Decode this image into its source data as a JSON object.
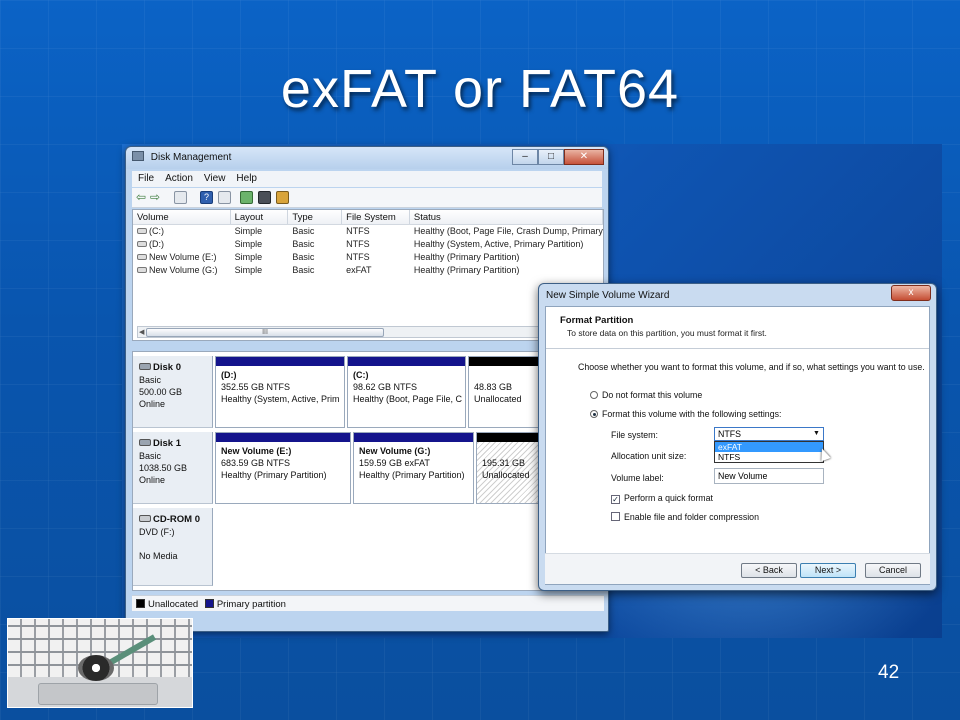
{
  "slide": {
    "title": "exFAT or FAT64",
    "page_number": "42"
  },
  "disk_management": {
    "window_title": "Disk Management",
    "menu": [
      "File",
      "Action",
      "View",
      "Help"
    ],
    "columns": [
      "Volume",
      "Layout",
      "Type",
      "File System",
      "Status"
    ],
    "volumes": [
      {
        "volume": "(C:)",
        "layout": "Simple",
        "type": "Basic",
        "fs": "NTFS",
        "status": "Healthy (Boot, Page File, Crash Dump, Primary"
      },
      {
        "volume": "(D:)",
        "layout": "Simple",
        "type": "Basic",
        "fs": "NTFS",
        "status": "Healthy (System, Active, Primary Partition)"
      },
      {
        "volume": "New Volume (E:)",
        "layout": "Simple",
        "type": "Basic",
        "fs": "NTFS",
        "status": "Healthy (Primary Partition)"
      },
      {
        "volume": "New Volume (G:)",
        "layout": "Simple",
        "type": "Basic",
        "fs": "exFAT",
        "status": "Healthy (Primary Partition)"
      }
    ],
    "scroll_thumb": "III",
    "disks": [
      {
        "name": "Disk 0",
        "kind": "Basic",
        "size": "500.00 GB",
        "state": "Online",
        "partitions": [
          {
            "title": "(D:)",
            "size": "352.55 GB NTFS",
            "status": "Healthy (System, Active, Prim"
          },
          {
            "title": "(C:)",
            "size": "98.62 GB NTFS",
            "status": "Healthy (Boot, Page File, C"
          },
          {
            "title": "",
            "size": "48.83 GB",
            "status": "Unallocated"
          }
        ]
      },
      {
        "name": "Disk 1",
        "kind": "Basic",
        "size": "1038.50 GB",
        "state": "Online",
        "partitions": [
          {
            "title": "New Volume  (E:)",
            "size": "683.59 GB NTFS",
            "status": "Healthy (Primary Partition)"
          },
          {
            "title": "New Volume  (G:)",
            "size": "159.59 GB exFAT",
            "status": "Healthy (Primary Partition)"
          },
          {
            "title": "",
            "size": "195.31 GB",
            "status": "Unallocated"
          }
        ]
      },
      {
        "name": "CD-ROM 0",
        "kind": "DVD (F:)",
        "size": "",
        "state": "No Media",
        "partitions": []
      }
    ],
    "legend": [
      "Unallocated",
      "Primary partition"
    ],
    "colors": {
      "primary_partition": "#14148c",
      "unallocated": "#000000"
    }
  },
  "wizard": {
    "title": "New Simple Volume Wizard",
    "close_label": "x",
    "heading": "Format Partition",
    "subheading": "To store data on this partition, you must format it first.",
    "instruction": "Choose whether you want to format this volume, and if so, what settings you want to use.",
    "radio_no_format": "Do not format this volume",
    "radio_format": "Format this volume with the following settings:",
    "file_system_label": "File system:",
    "file_system_value": "NTFS",
    "file_system_options": [
      "exFAT",
      "NTFS"
    ],
    "file_system_highlighted": "exFAT",
    "allocation_label": "Allocation unit size:",
    "volume_label_label": "Volume label:",
    "volume_label_value": "New Volume",
    "quick_format": "Perform a quick format",
    "quick_format_checked": true,
    "compression": "Enable file and folder compression",
    "compression_checked": false,
    "buttons": {
      "back": "< Back",
      "next": "Next >",
      "cancel": "Cancel"
    }
  }
}
